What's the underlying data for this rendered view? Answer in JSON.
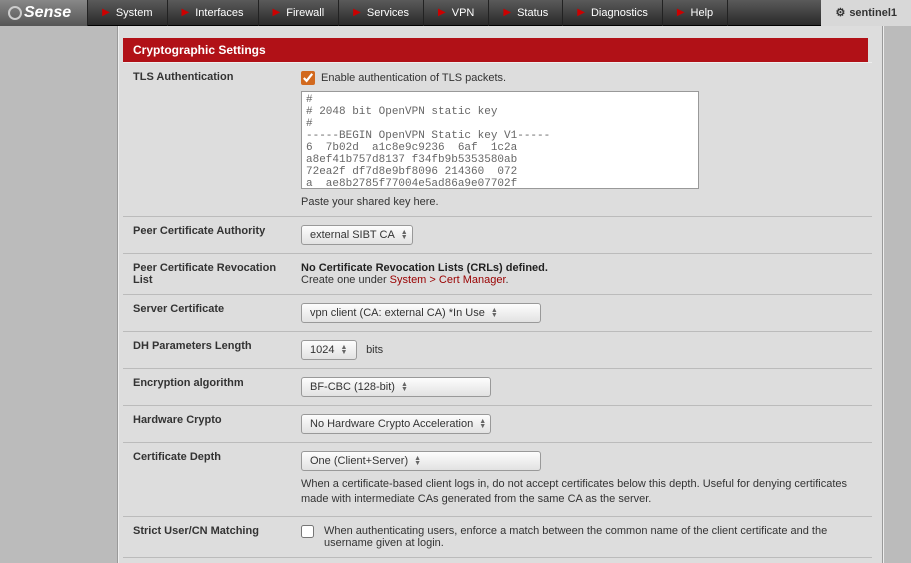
{
  "brand": "Sense",
  "nav": {
    "items": [
      "System",
      "Interfaces",
      "Firewall",
      "Services",
      "VPN",
      "Status",
      "Diagnostics",
      "Help"
    ]
  },
  "hostname": "sentinel1",
  "panel": {
    "title": "Cryptographic Settings"
  },
  "rows": {
    "tls_auth": {
      "label": "TLS Authentication",
      "checkbox_label": "Enable authentication of TLS packets.",
      "key_text": "#\n# 2048 bit OpenVPN static key\n#\n-----BEGIN OpenVPN Static key V1-----\n6  7b02d  a1c8e9c9236  6af  1c2a\na8ef41b757d8137 f34fb9b5353580ab\n72ea2f df7d8e9bf8096 214360  072\na  ae8b2785f77004e5ad86a9e07702f",
      "hint": "Paste your shared key here."
    },
    "peer_ca": {
      "label": "Peer Certificate Authority",
      "value": "external SIBT CA"
    },
    "peer_crl": {
      "label": "Peer Certificate Revocation List",
      "none_text": "No Certificate Revocation Lists (CRLs) defined.",
      "create_prefix": "Create one under ",
      "create_link": "System > Cert Manager",
      "create_suffix": "."
    },
    "server_cert": {
      "label": "Server Certificate",
      "value": "vpn client       (CA: external      CA) *In Use"
    },
    "dh": {
      "label": "DH Parameters Length",
      "value": "1024",
      "suffix": "bits"
    },
    "enc": {
      "label": "Encryption algorithm",
      "value": "BF-CBC (128-bit)"
    },
    "hw": {
      "label": "Hardware Crypto",
      "value": "No Hardware Crypto Acceleration"
    },
    "depth": {
      "label": "Certificate Depth",
      "value": "One (Client+Server)",
      "desc": "When a certificate-based client logs in, do not accept certificates below this depth. Useful for denying certificates made with intermediate CAs generated from the same CA as the server."
    },
    "strict": {
      "label": "Strict User/CN Matching",
      "desc": "When authenticating users, enforce a match between the common name of the client certificate and the username given at login."
    }
  }
}
